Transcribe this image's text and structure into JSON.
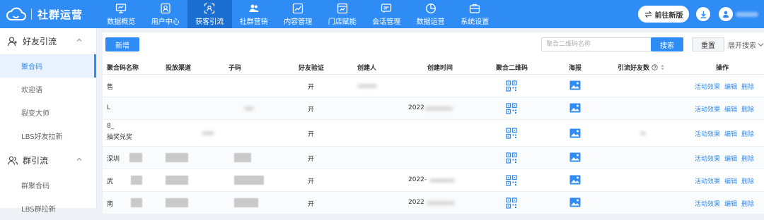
{
  "app": {
    "title": "社群运营"
  },
  "nav": {
    "items": [
      {
        "label": "数据概览",
        "icon": "monitor-icon"
      },
      {
        "label": "用户中心",
        "icon": "user-card-icon"
      },
      {
        "label": "获客引流",
        "icon": "scan-icon",
        "active": true
      },
      {
        "label": "社群营销",
        "icon": "group-icon"
      },
      {
        "label": "内容管理",
        "icon": "chart-line-icon"
      },
      {
        "label": "门店赋能",
        "icon": "store-chart-icon"
      },
      {
        "label": "会话管理",
        "icon": "chat-icon"
      },
      {
        "label": "数据运营",
        "icon": "pie-icon"
      },
      {
        "label": "系统设置",
        "icon": "briefcase-icon"
      }
    ],
    "goto_new": "前往新版"
  },
  "sidebar": {
    "groups": [
      {
        "label": "好友引流",
        "items": [
          "聚合码",
          "欢迎语",
          "裂变大师",
          "LBS好友拉新"
        ]
      },
      {
        "label": "群引流",
        "items": [
          "群聚合码",
          "LBS群拉新"
        ]
      }
    ],
    "active_item": "聚合码"
  },
  "toolbar": {
    "new_label": "新增",
    "search_placeholder": "聚合二维码名称",
    "search_label": "搜索",
    "reset_label": "重置",
    "expand_label": "展开搜索"
  },
  "table": {
    "headers": [
      "聚合码名称",
      "投放渠道",
      "子码",
      "好友验证",
      "创建人",
      "创建时间",
      "聚合二维码",
      "海报",
      "引流好友数",
      "操作"
    ],
    "rows": [
      {
        "name": "售",
        "verify": "开",
        "time": ""
      },
      {
        "name": "L",
        "verify": "开",
        "time": "2022"
      },
      {
        "name": "8_",
        "name2": "抽奖兑奖",
        "verify": "开",
        "time": ""
      },
      {
        "name": "深圳",
        "verify": "开",
        "time": ""
      },
      {
        "name": "武",
        "verify": "开",
        "time": "2022-"
      },
      {
        "name": "南",
        "verify": "开",
        "time": "2022"
      }
    ],
    "actions": [
      "活动效果",
      "编辑",
      "删除"
    ]
  },
  "colors": {
    "primary": "#2f8cf5",
    "active_nav": "#1b6fd3"
  }
}
